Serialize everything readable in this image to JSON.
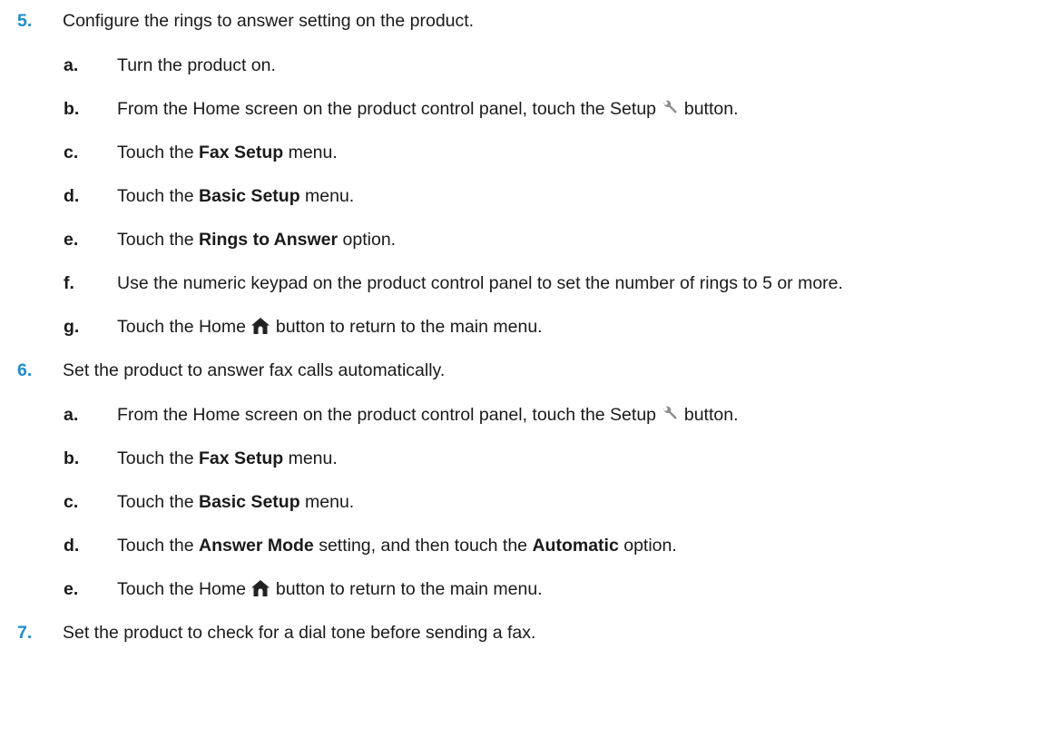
{
  "steps": [
    {
      "number": "5.",
      "text": "Configure the rings to answer setting on the product.",
      "substeps": [
        {
          "letter": "a.",
          "text": "Turn the product on."
        },
        {
          "letter": "b.",
          "pre": "From the Home screen on the product control panel, touch the Setup",
          "post": "button.",
          "icon": "wrench-icon"
        },
        {
          "letter": "c.",
          "pre": "Touch the",
          "bold": "Fax Setup",
          "post": "menu."
        },
        {
          "letter": "d.",
          "pre": "Touch the",
          "bold": "Basic Setup",
          "post": "menu."
        },
        {
          "letter": "e.",
          "pre": "Touch the",
          "bold": "Rings to Answer",
          "post": "option."
        },
        {
          "letter": "f.",
          "text": "Use the numeric keypad on the product control panel to set the number of rings to 5 or more."
        },
        {
          "letter": "g.",
          "pre": "Touch the Home",
          "post": "button to return to the main menu.",
          "icon": "home-icon"
        }
      ]
    },
    {
      "number": "6.",
      "text": "Set the product to answer fax calls automatically.",
      "substeps": [
        {
          "letter": "a.",
          "pre": "From the Home screen on the product control panel, touch the Setup",
          "post": "button.",
          "icon": "wrench-icon"
        },
        {
          "letter": "b.",
          "pre": "Touch the",
          "bold": "Fax Setup",
          "post": "menu."
        },
        {
          "letter": "c.",
          "pre": "Touch the",
          "bold": "Basic Setup",
          "post": "menu."
        },
        {
          "letter": "d.",
          "pre": "Touch the",
          "bold": "Answer Mode",
          "mid": "setting, and then touch the",
          "bold2": "Automatic",
          "post": "option."
        },
        {
          "letter": "e.",
          "pre": "Touch the Home",
          "post": "button to return to the main menu.",
          "icon": "home-icon"
        }
      ]
    },
    {
      "number": "7.",
      "text": "Set the product to check for a dial tone before sending a fax.",
      "substeps": []
    }
  ],
  "colors": {
    "step_number": "#1e8ccd",
    "text": "#1a1a1a"
  }
}
